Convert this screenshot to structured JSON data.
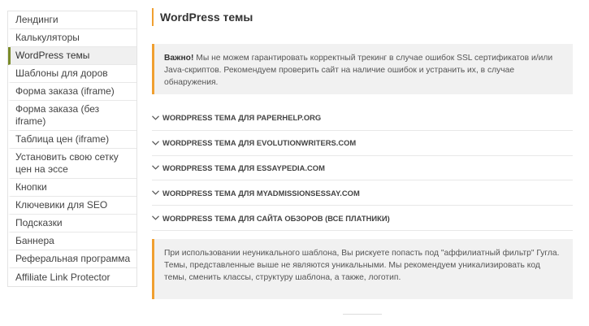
{
  "sidebar": {
    "items": [
      {
        "label": "Лендинги",
        "active": false
      },
      {
        "label": "Калькуляторы",
        "active": false
      },
      {
        "label": "WordPress темы",
        "active": true
      },
      {
        "label": "Шаблоны для доров",
        "active": false
      },
      {
        "label": "Форма заказа (iframe)",
        "active": false
      },
      {
        "label": "Форма заказа (без iframe)",
        "active": false
      },
      {
        "label": "Таблица цен (iframe)",
        "active": false
      },
      {
        "label": "Установить свою сетку цен на эссе",
        "active": false
      },
      {
        "label": "Кнопки",
        "active": false
      },
      {
        "label": "Ключевики для SEO",
        "active": false
      },
      {
        "label": "Подсказки",
        "active": false
      },
      {
        "label": "Баннера",
        "active": false
      },
      {
        "label": "Реферальная программа",
        "active": false
      },
      {
        "label": "Affiliate Link Protector",
        "active": false
      }
    ]
  },
  "main": {
    "title": "WordPress темы",
    "notice_top": {
      "strong": "Важно!",
      "text": " Мы не можем гарантировать корректный трекинг в случае ошибок SSL сертификатов и/или Java-скриптов. Рекомендуем проверить сайт на наличие ошибок и устранить их, в случае обнаружения."
    },
    "accordion": [
      "WORDPRESS ТЕМА ДЛЯ PAPERHELP.ORG",
      "WORDPRESS ТЕМА ДЛЯ EVOLUTIONWRITERS.COM",
      "WORDPRESS ТЕМА ДЛЯ ESSAYPEDIA.COM",
      "WORDPRESS ТЕМА ДЛЯ MYADMISSIONSESSAY.COM",
      "WORDPRESS ТЕМА ДЛЯ САЙТА ОБЗОРОВ (ВСЕ ПЛАТНИКИ)"
    ],
    "notice_bottom": "При использовании неуникального шаблона, Вы рискуете попасть под \"аффилиатный фильтр\" Гугла. Темы, представленные выше не являются уникальными. Мы рекомендуем уникализировать код темы, сменить классы, структуру шаблона, а также, логотип."
  },
  "icons": {
    "accordion_toggle": "chevron-down-icon"
  },
  "colors": {
    "accent": "#f0a030",
    "active_border": "#7a8b2a",
    "notice_bg": "#f1f1f1"
  }
}
